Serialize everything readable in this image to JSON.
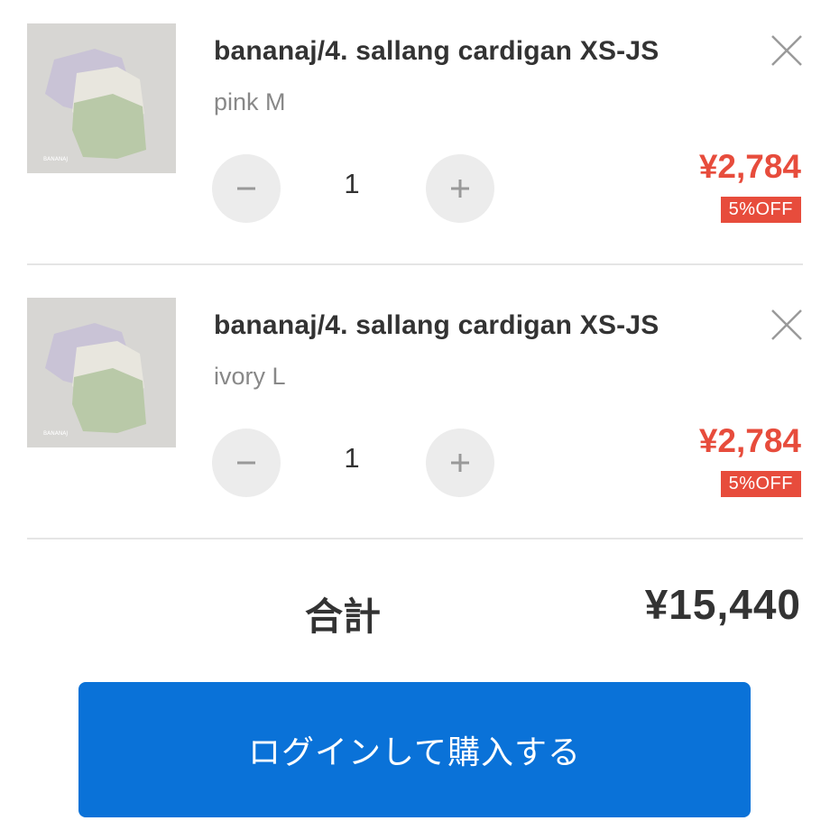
{
  "cart": {
    "items": [
      {
        "title": "bananaj/4. sallang cardigan XS-JS",
        "variant": "pink M",
        "quantity": "1",
        "price": "¥2,784",
        "discount": "5%OFF",
        "image_icon": "product-photo-cardigans",
        "remove_icon": "close-icon"
      },
      {
        "title": "bananaj/4. sallang cardigan XS-JS",
        "variant": "ivory L",
        "quantity": "1",
        "price": "¥2,784",
        "discount": "5%OFF",
        "image_icon": "product-photo-cardigans",
        "remove_icon": "close-icon"
      }
    ],
    "total_label": "合計",
    "total_value": "¥15,440",
    "checkout_label": "ログインして購入する"
  },
  "colors": {
    "price": "#e74c3c",
    "discount_badge": "#e74c3c",
    "checkout_button": "#0a72d8",
    "qty_button_bg": "#ececec"
  },
  "icons": {
    "minus": "minus-icon",
    "plus": "plus-icon",
    "remove": "close-icon"
  }
}
